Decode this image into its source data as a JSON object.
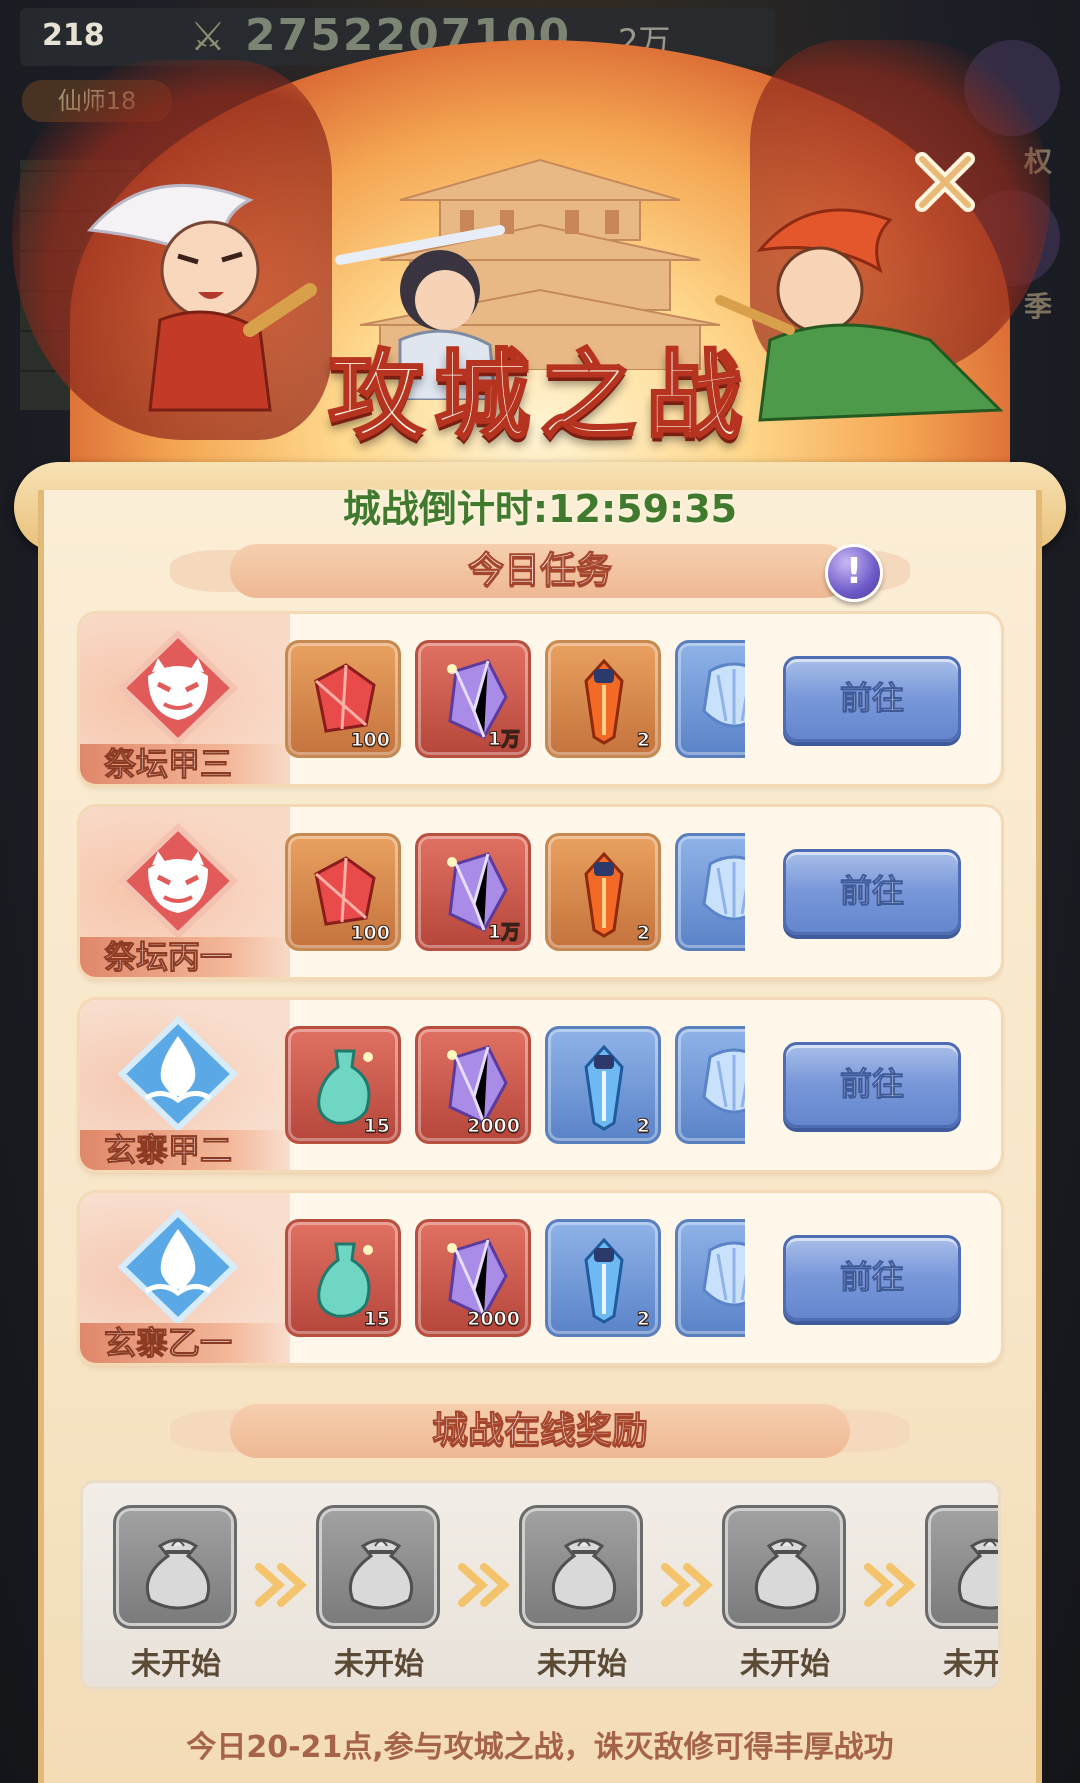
{
  "hud": {
    "level": "218",
    "power": "2752207100",
    "money": "2万",
    "title_tag": "仙师18",
    "side_label_1": "权",
    "side_label_2": "季"
  },
  "event": {
    "title": "攻城之战",
    "countdown_label": "城战倒计时:",
    "countdown": "12:59:35"
  },
  "tasks_section": {
    "title": "今日任务",
    "info_icon": "exclamation-icon"
  },
  "tasks": [
    {
      "name": "祭坛甲三",
      "emblem": "demon-mask-icon",
      "go": "前往",
      "rewards": [
        {
          "icon": "red-crystal-icon",
          "qty": "100"
        },
        {
          "icon": "purple-crystal-icon",
          "qty": "1万"
        },
        {
          "icon": "fire-gem-icon",
          "qty": "2"
        },
        {
          "icon": "blue-shell-icon",
          "qty": ""
        }
      ]
    },
    {
      "name": "祭坛丙一",
      "emblem": "demon-mask-icon",
      "go": "前往",
      "rewards": [
        {
          "icon": "red-crystal-icon",
          "qty": "100"
        },
        {
          "icon": "purple-crystal-icon",
          "qty": "1万"
        },
        {
          "icon": "fire-gem-icon",
          "qty": "2"
        },
        {
          "icon": "blue-shell-icon",
          "qty": ""
        }
      ]
    },
    {
      "name": "玄寨甲二",
      "emblem": "water-drop-icon",
      "go": "前往",
      "rewards": [
        {
          "icon": "jade-vase-icon",
          "qty": "15"
        },
        {
          "icon": "purple-crystal-icon",
          "qty": "2000"
        },
        {
          "icon": "ice-gem-icon",
          "qty": "2"
        },
        {
          "icon": "blue-shell-icon",
          "qty": ""
        }
      ]
    },
    {
      "name": "玄寨乙一",
      "emblem": "water-drop-icon",
      "go": "前往",
      "rewards": [
        {
          "icon": "jade-vase-icon",
          "qty": "15"
        },
        {
          "icon": "purple-crystal-icon",
          "qty": "2000"
        },
        {
          "icon": "ice-gem-icon",
          "qty": "2"
        },
        {
          "icon": "blue-shell-icon",
          "qty": ""
        }
      ]
    }
  ],
  "online_section": {
    "title": "城战在线奖励",
    "rewards": [
      {
        "status": "未开始",
        "icon": "money-bag-icon"
      },
      {
        "status": "未开始",
        "icon": "money-bag-icon"
      },
      {
        "status": "未开始",
        "icon": "money-bag-icon"
      },
      {
        "status": "未开始",
        "icon": "money-bag-icon"
      },
      {
        "status": "未开始",
        "icon": "money-bag-icon"
      }
    ]
  },
  "footer": "今日20-21点,参与攻城之战，诛灭敌修可得丰厚战功",
  "colors": {
    "title_stroke": "#b6331f",
    "countdown": "#3f7a2e",
    "go_button": "#7797d9",
    "panel": "#fbeed6"
  }
}
